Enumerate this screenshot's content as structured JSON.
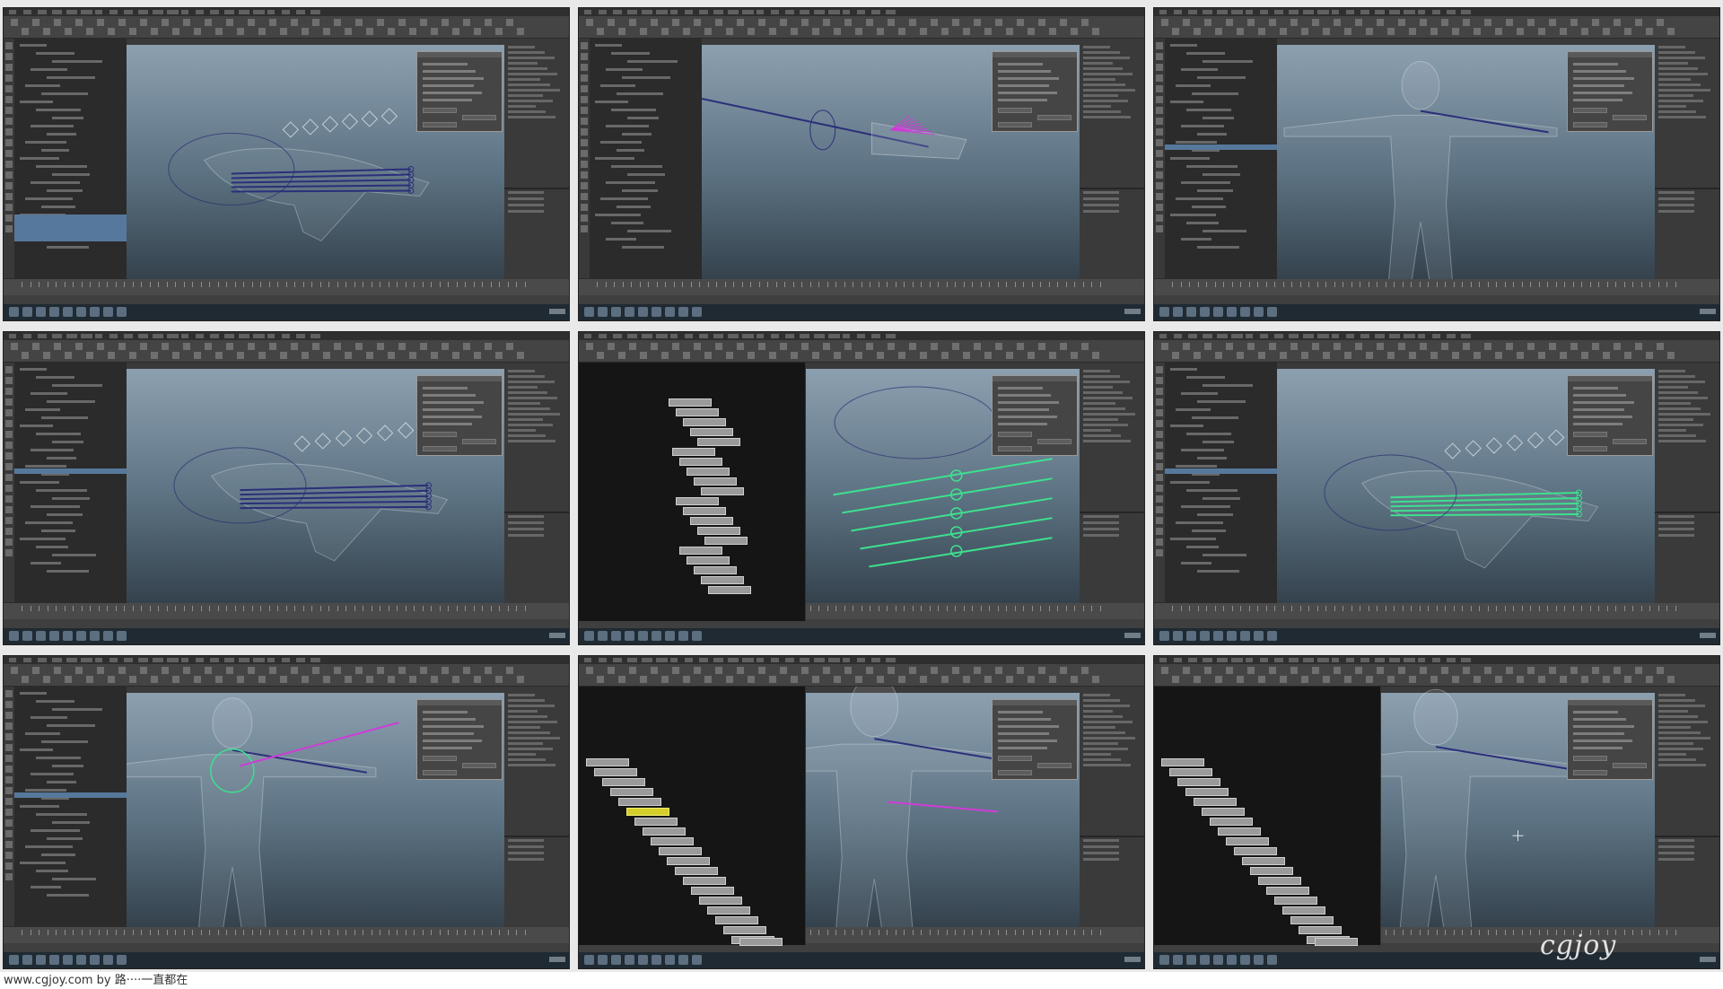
{
  "page": {
    "footer_text": "www.cgjoy.com by 路····一直都在",
    "watermark_text": "cgjoy"
  },
  "colors": {
    "viewport_top": "#8ea2b2",
    "viewport_bottom": "#34424d",
    "joint_selected": "#3ee08e",
    "joint_default": "#2b2f7a",
    "control_magenta": "#d03bd8",
    "node_highlight": "#d4cf2a",
    "outliner_selection": "#56789c"
  },
  "icons": {
    "viewport_cursor": "crosshair-icon",
    "window_close": "close-icon"
  },
  "panels": [
    {
      "id": "p1",
      "layout": "outliner",
      "scene": "hand-wire",
      "selection": "partial"
    },
    {
      "id": "p2",
      "layout": "outliner",
      "scene": "arm-magenta",
      "selection": "none"
    },
    {
      "id": "p3",
      "layout": "outliner",
      "scene": "body-tpose",
      "selection": "single"
    },
    {
      "id": "p4",
      "layout": "outliner",
      "scene": "hand-wire-dark",
      "selection": "single"
    },
    {
      "id": "p5",
      "layout": "hypergraph",
      "scene": "arm-green",
      "selection": "none"
    },
    {
      "id": "p6",
      "layout": "outliner",
      "scene": "hand-green",
      "selection": "single"
    },
    {
      "id": "p7",
      "layout": "outliner",
      "scene": "body-shoulder",
      "selection": "single"
    },
    {
      "id": "p8",
      "layout": "hypergraph",
      "scene": "body-shoulder-close",
      "selection": "highlight"
    },
    {
      "id": "p9",
      "layout": "hypergraph",
      "scene": "body-arm-far",
      "selection": "none"
    }
  ]
}
